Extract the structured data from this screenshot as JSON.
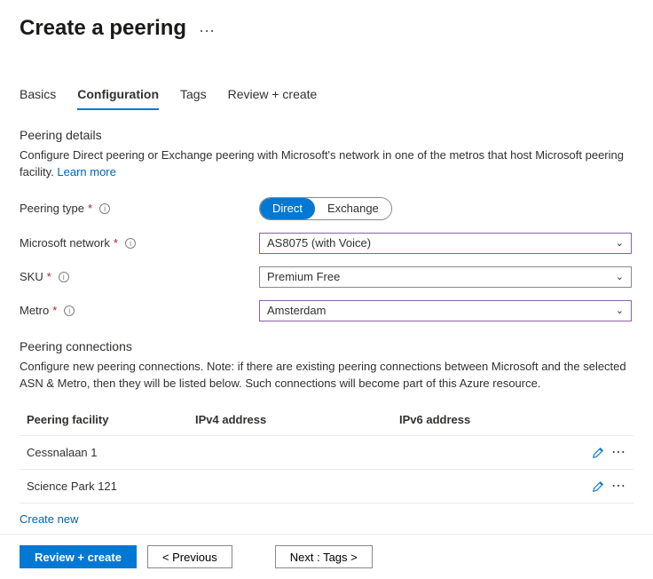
{
  "header": {
    "title": "Create a peering"
  },
  "tabs": {
    "items": [
      {
        "label": "Basics"
      },
      {
        "label": "Configuration"
      },
      {
        "label": "Tags"
      },
      {
        "label": "Review + create"
      }
    ],
    "active_index": 1
  },
  "details": {
    "heading": "Peering details",
    "description": "Configure Direct peering or Exchange peering with Microsoft's network in one of the metros that host Microsoft peering facility. ",
    "learn_more": "Learn more"
  },
  "form": {
    "peering_type": {
      "label": "Peering type",
      "options": {
        "direct": "Direct",
        "exchange": "Exchange"
      },
      "selected": "direct"
    },
    "ms_network": {
      "label": "Microsoft network",
      "value": "AS8075 (with Voice)"
    },
    "sku": {
      "label": "SKU",
      "value": "Premium Free"
    },
    "metro": {
      "label": "Metro",
      "value": "Amsterdam"
    }
  },
  "connections": {
    "heading": "Peering connections",
    "description": "Configure new peering connections. Note: if there are existing peering connections between Microsoft and the selected ASN & Metro, then they will be listed below. Such connections will become part of this Azure resource.",
    "columns": {
      "facility": "Peering facility",
      "ipv4": "IPv4 address",
      "ipv6": "IPv6 address"
    },
    "rows": [
      {
        "facility": "Cessnalaan 1",
        "ipv4": "",
        "ipv6": ""
      },
      {
        "facility": "Science Park 121",
        "ipv4": "",
        "ipv6": ""
      }
    ],
    "create_new": "Create new"
  },
  "footer": {
    "review": "Review + create",
    "previous": "< Previous",
    "next": "Next : Tags >"
  }
}
